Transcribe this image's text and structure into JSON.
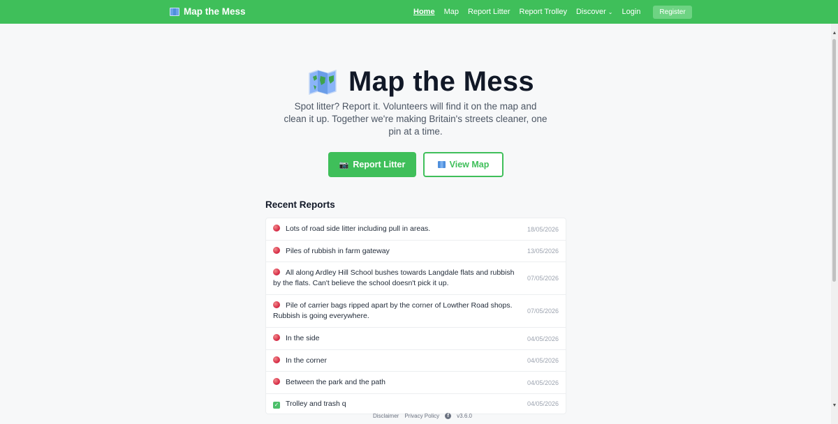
{
  "nav": {
    "brand": "Map the Mess",
    "links": [
      {
        "label": "Home",
        "active": true
      },
      {
        "label": "Map"
      },
      {
        "label": "Report Litter"
      },
      {
        "label": "Report Trolley"
      },
      {
        "label": "Discover"
      },
      {
        "label": "Login"
      }
    ],
    "register": "Register"
  },
  "hero": {
    "title": "Map the Mess",
    "subtitle": "Spot litter? Report it. Volunteers will find it on the map and clean it up. Together we're making Britain's streets cleaner, one pin at a time.",
    "primary_button": "Report Litter",
    "secondary_button": "View Map"
  },
  "recent": {
    "heading": "Recent Reports",
    "items": [
      {
        "icon": "red-dot",
        "text": "Lots of road side litter including pull in areas.",
        "date": "18/05/2026"
      },
      {
        "icon": "red-dot",
        "text": "Piles of rubbish in farm gateway",
        "date": "13/05/2026"
      },
      {
        "icon": "red-dot",
        "text": "All along Ardley Hill School bushes towards Langdale flats and rubbish by the flats. Can't believe the school doesn't pick it up.",
        "date": "07/05/2026"
      },
      {
        "icon": "red-dot",
        "text": "Pile of carrier bags ripped apart by the corner of Lowther Road shops. Rubbish is going everywhere.",
        "date": "07/05/2026"
      },
      {
        "icon": "red-dot",
        "text": "In the side",
        "date": "04/05/2026"
      },
      {
        "icon": "red-dot",
        "text": "In the corner",
        "date": "04/05/2026"
      },
      {
        "icon": "red-dot",
        "text": "Between the park and the path",
        "date": "04/05/2026"
      },
      {
        "icon": "check",
        "text": "Trolley and trash q",
        "date": "04/05/2026"
      }
    ]
  },
  "footer": {
    "disclaimer": "Disclaimer",
    "privacy": "Privacy Policy",
    "version": "v3.6.0"
  },
  "colors": {
    "brand_green": "#3fbf5a",
    "report_dot": "#d9304a"
  }
}
